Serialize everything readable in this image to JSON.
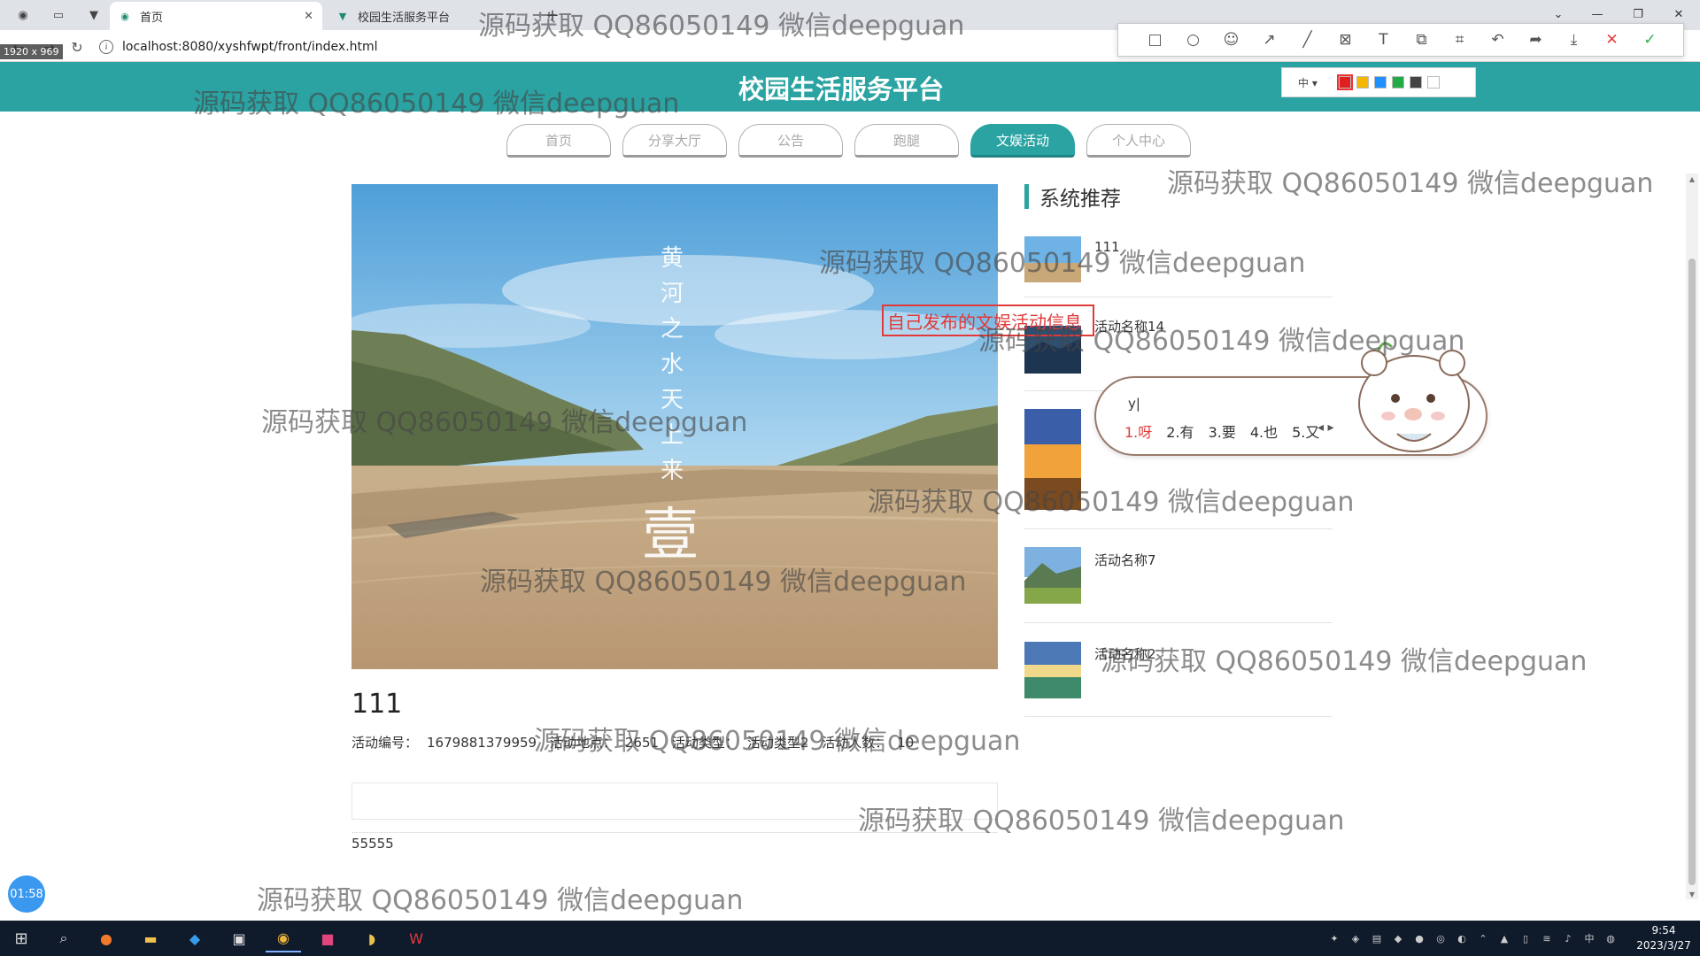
{
  "browser": {
    "tabs": [
      {
        "label": "首页",
        "active": true
      },
      {
        "label": "校园生活服务平台",
        "active": false
      }
    ],
    "url": "localhost:8080/xyshfwpt/front/index.html",
    "dimensions_badge": "1920 x 969",
    "new_tab": "+"
  },
  "snip": {
    "size_label": "中 ▾",
    "colors": [
      "#e02020",
      "#f5b800",
      "#1e90ff",
      "#22aa44",
      "#444444",
      "#ffffff"
    ]
  },
  "site": {
    "title": "校园生活服务平台",
    "nav": [
      {
        "label": "首页",
        "active": false
      },
      {
        "label": "分享大厅",
        "active": false
      },
      {
        "label": "公告",
        "active": false
      },
      {
        "label": "跑腿",
        "active": false
      },
      {
        "label": "文娱活动",
        "active": true
      },
      {
        "label": "个人中心",
        "active": false
      }
    ]
  },
  "hero": {
    "poem_chars": [
      "黄",
      "河",
      "之",
      "水",
      "天",
      "上",
      "来"
    ],
    "calligraphy": "壹"
  },
  "activity": {
    "title": "111",
    "id_label": "活动编号：",
    "id_value": "1679881379959",
    "place_label": "活动地点：",
    "place_value": "2651",
    "type_label": "活动类型：",
    "type_value": "活动类型2",
    "count_label": "活动人数：",
    "count_value": "10",
    "content_text": "55555"
  },
  "sidebar": {
    "title": "系统推荐",
    "items": [
      {
        "label": "111"
      },
      {
        "label": "活动名称14"
      },
      {
        "label": ""
      },
      {
        "label": "活动名称7"
      },
      {
        "label": "活动名称2"
      }
    ]
  },
  "annotation": {
    "text": "自己发布的文娱活动信息"
  },
  "ime": {
    "input": "y|",
    "candidates": [
      "1.呀",
      "2.有",
      "3.要",
      "4.也",
      "5.又"
    ],
    "arrows": "◂ ▸"
  },
  "watermark_text": "源码获取 QQ86050149 微信deepguan",
  "timer": "01:58",
  "taskbar": {
    "time": "9:54",
    "date": "2023/3/27",
    "ime_indicator": "中"
  }
}
